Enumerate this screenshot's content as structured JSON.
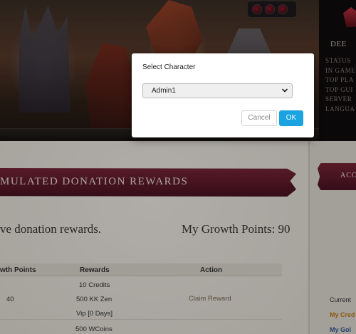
{
  "sidebar": {
    "title_partial": "DEE",
    "stats": [
      "STATUS",
      "IN GAME",
      "TOP PLA",
      "TOP GUI",
      "SERVER",
      "LANGUA"
    ],
    "section_partial": "ACC",
    "current_partial": "Current",
    "my_credits_partial": "My Cred",
    "my_gold_partial": "My Gol"
  },
  "page": {
    "section_title_partial": "MULATED DONATION REWARDS",
    "lead_text_partial": "ve donation rewards.",
    "growth_points_label": "My Growth Points: 90"
  },
  "table": {
    "headers": [
      "wth Points",
      "Rewards",
      "Action"
    ],
    "rows": [
      {
        "points": "40",
        "rewards": [
          "10 Credits",
          "500 KK Zen",
          "Vip [0 Days]"
        ],
        "action": "Claim Reward"
      },
      {
        "points": "",
        "rewards": [
          "500 WCoins"
        ],
        "action": ""
      }
    ]
  },
  "modal": {
    "title": "Select Character",
    "selected_character": "Admin1",
    "cancel_label": "Cancel",
    "ok_label": "OK"
  },
  "colors": {
    "ribbon": "#5c1a2a",
    "ok_button": "#1aa3e0",
    "credits_text": "#c07a1a",
    "gold_text": "#3a5aa0"
  }
}
